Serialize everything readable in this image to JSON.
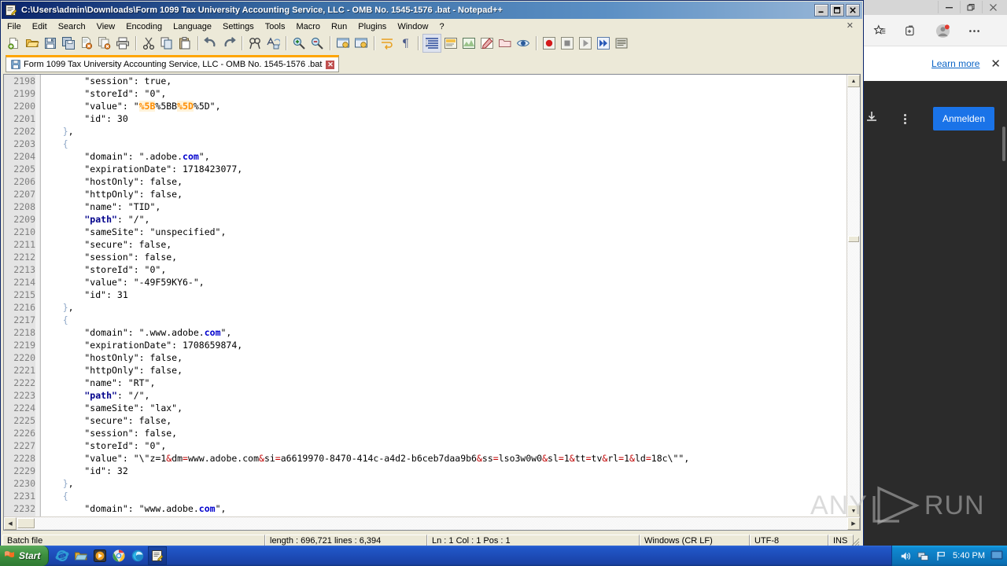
{
  "window": {
    "title": "C:\\Users\\admin\\Downloads\\Form 1099 Tax University Accounting Service, LLC - OMB No. 1545-1576 .bat - Notepad++",
    "icon": "notepad-plus-plus-icon",
    "minimize_label": "_",
    "maximize_label": "❐",
    "close_label": "✕"
  },
  "menu": {
    "items": [
      "File",
      "Edit",
      "Search",
      "View",
      "Encoding",
      "Language",
      "Settings",
      "Tools",
      "Macro",
      "Run",
      "Plugins",
      "Window",
      "?"
    ],
    "close_doc_label": "✕"
  },
  "toolbar": {
    "buttons": [
      {
        "name": "new-file-icon",
        "glyph": "new"
      },
      {
        "name": "open-file-icon",
        "glyph": "open"
      },
      {
        "name": "save-icon",
        "glyph": "save"
      },
      {
        "name": "save-all-icon",
        "glyph": "saveall"
      },
      {
        "name": "close-file-icon",
        "glyph": "close"
      },
      {
        "name": "close-all-files-icon",
        "glyph": "closeall"
      },
      {
        "name": "print-icon",
        "glyph": "print"
      },
      {
        "name": "cut-icon",
        "glyph": "cut"
      },
      {
        "name": "copy-icon",
        "glyph": "copy"
      },
      {
        "name": "paste-icon",
        "glyph": "paste"
      },
      {
        "name": "undo-icon",
        "glyph": "undo"
      },
      {
        "name": "redo-icon",
        "glyph": "redo"
      },
      {
        "name": "find-icon",
        "glyph": "find"
      },
      {
        "name": "replace-icon",
        "glyph": "replace"
      },
      {
        "name": "zoom-in-icon",
        "glyph": "zoomin"
      },
      {
        "name": "zoom-out-icon",
        "glyph": "zoomout"
      },
      {
        "name": "sync-vertical-scroll-icon",
        "glyph": "syncv"
      },
      {
        "name": "sync-horizontal-scroll-icon",
        "glyph": "synch"
      },
      {
        "name": "word-wrap-icon",
        "glyph": "wrap"
      },
      {
        "name": "show-all-characters-icon",
        "glyph": "pilcrow"
      },
      {
        "name": "indent-guide-icon",
        "glyph": "indent"
      },
      {
        "name": "user-defined-language-icon",
        "glyph": "udl"
      },
      {
        "name": "document-map-icon",
        "glyph": "map"
      },
      {
        "name": "function-list-icon",
        "glyph": "funclist"
      },
      {
        "name": "folder-as-workspace-icon",
        "glyph": "folderws"
      },
      {
        "name": "monitoring-icon",
        "glyph": "eye"
      },
      {
        "name": "record-macro-icon",
        "glyph": "record"
      },
      {
        "name": "stop-macro-icon",
        "glyph": "stop"
      },
      {
        "name": "play-macro-icon",
        "glyph": "play"
      },
      {
        "name": "run-macro-multiple-icon",
        "glyph": "playmulti"
      },
      {
        "name": "run-icon",
        "glyph": "run"
      }
    ]
  },
  "document_tab": {
    "label": "Form 1099 Tax University Accounting Service, LLC - OMB No. 1545-1576 .bat",
    "icon": "save-blue-icon",
    "close_label": "✕"
  },
  "editor": {
    "first_line_number": 2198,
    "lines": [
      {
        "n": 2198,
        "tokens": [
          {
            "t": "        \"session\": true,",
            "c": "k-key"
          }
        ]
      },
      {
        "n": 2199,
        "tokens": [
          {
            "t": "        \"storeId\": \"0\",",
            "c": "k-key"
          }
        ]
      },
      {
        "n": 2200,
        "tokens": [
          {
            "t": "        \"value\": \"",
            "c": "k-key"
          },
          {
            "t": "%5B",
            "c": "k-hl"
          },
          {
            "t": "%5BB",
            "c": "k-key"
          },
          {
            "t": "%5D",
            "c": "k-hl"
          },
          {
            "t": "%5D\",",
            "c": "k-key"
          }
        ]
      },
      {
        "n": 2201,
        "tokens": [
          {
            "t": "        \"id\": 30",
            "c": "k-key"
          }
        ]
      },
      {
        "n": 2202,
        "tokens": [
          {
            "t": "    }",
            "c": "k-brace"
          },
          {
            "t": ",",
            "c": "k-key"
          }
        ]
      },
      {
        "n": 2203,
        "tokens": [
          {
            "t": "    {",
            "c": "k-brace"
          }
        ]
      },
      {
        "n": 2204,
        "tokens": [
          {
            "t": "        \"domain\": \".adobe.",
            "c": "k-key"
          },
          {
            "t": "com",
            "c": "k-com"
          },
          {
            "t": "\",",
            "c": "k-key"
          }
        ]
      },
      {
        "n": 2205,
        "tokens": [
          {
            "t": "        \"expirationDate\": 1718423077,",
            "c": "k-key"
          }
        ]
      },
      {
        "n": 2206,
        "tokens": [
          {
            "t": "        \"hostOnly\": false,",
            "c": "k-key"
          }
        ]
      },
      {
        "n": 2207,
        "tokens": [
          {
            "t": "        \"httpOnly\": false,",
            "c": "k-key"
          }
        ]
      },
      {
        "n": 2208,
        "tokens": [
          {
            "t": "        \"name\": \"TID\",",
            "c": "k-key"
          }
        ]
      },
      {
        "n": 2209,
        "tokens": [
          {
            "t": "        \"path\"",
            "c": "k-path"
          },
          {
            "t": ": \"/\",",
            "c": "k-key"
          }
        ]
      },
      {
        "n": 2210,
        "tokens": [
          {
            "t": "        \"sameSite\": \"unspecified\",",
            "c": "k-key"
          }
        ]
      },
      {
        "n": 2211,
        "tokens": [
          {
            "t": "        \"secure\": false,",
            "c": "k-key"
          }
        ]
      },
      {
        "n": 2212,
        "tokens": [
          {
            "t": "        \"session\": false,",
            "c": "k-key"
          }
        ]
      },
      {
        "n": 2213,
        "tokens": [
          {
            "t": "        \"storeId\": \"0\",",
            "c": "k-key"
          }
        ]
      },
      {
        "n": 2214,
        "tokens": [
          {
            "t": "        \"value\": \"-49F59KY6-\",",
            "c": "k-key"
          }
        ]
      },
      {
        "n": 2215,
        "tokens": [
          {
            "t": "        \"id\": 31",
            "c": "k-key"
          }
        ]
      },
      {
        "n": 2216,
        "tokens": [
          {
            "t": "    }",
            "c": "k-brace"
          },
          {
            "t": ",",
            "c": "k-key"
          }
        ]
      },
      {
        "n": 2217,
        "tokens": [
          {
            "t": "    {",
            "c": "k-brace"
          }
        ]
      },
      {
        "n": 2218,
        "tokens": [
          {
            "t": "        \"domain\": \".www.adobe.",
            "c": "k-key"
          },
          {
            "t": "com",
            "c": "k-com"
          },
          {
            "t": "\",",
            "c": "k-key"
          }
        ]
      },
      {
        "n": 2219,
        "tokens": [
          {
            "t": "        \"expirationDate\": 1708659874,",
            "c": "k-key"
          }
        ]
      },
      {
        "n": 2220,
        "tokens": [
          {
            "t": "        \"hostOnly\": false,",
            "c": "k-key"
          }
        ]
      },
      {
        "n": 2221,
        "tokens": [
          {
            "t": "        \"httpOnly\": false,",
            "c": "k-key"
          }
        ]
      },
      {
        "n": 2222,
        "tokens": [
          {
            "t": "        \"name\": \"RT\",",
            "c": "k-key"
          }
        ]
      },
      {
        "n": 2223,
        "tokens": [
          {
            "t": "        \"path\"",
            "c": "k-path"
          },
          {
            "t": ": \"/\",",
            "c": "k-key"
          }
        ]
      },
      {
        "n": 2224,
        "tokens": [
          {
            "t": "        \"sameSite\": \"lax\",",
            "c": "k-key"
          }
        ]
      },
      {
        "n": 2225,
        "tokens": [
          {
            "t": "        \"secure\": false,",
            "c": "k-key"
          }
        ]
      },
      {
        "n": 2226,
        "tokens": [
          {
            "t": "        \"session\": false,",
            "c": "k-key"
          }
        ]
      },
      {
        "n": 2227,
        "tokens": [
          {
            "t": "        \"storeId\": \"0\",",
            "c": "k-key"
          }
        ]
      },
      {
        "n": 2228,
        "tokens": [
          {
            "t": "        \"value\": \"\\\"z=1",
            "c": "k-key"
          },
          {
            "t": "&",
            "c": "k-amp"
          },
          {
            "t": "dm",
            "c": "k-key"
          },
          {
            "t": "=",
            "c": "k-amp"
          },
          {
            "t": "www.adobe.com",
            "c": "k-key"
          },
          {
            "t": "&",
            "c": "k-amp"
          },
          {
            "t": "si",
            "c": "k-key"
          },
          {
            "t": "=",
            "c": "k-amp"
          },
          {
            "t": "a6619970-8470-414c-a4d2-b6ceb7daa9b6",
            "c": "k-key"
          },
          {
            "t": "&",
            "c": "k-amp"
          },
          {
            "t": "ss",
            "c": "k-key"
          },
          {
            "t": "=",
            "c": "k-amp"
          },
          {
            "t": "lso3w0w0",
            "c": "k-key"
          },
          {
            "t": "&",
            "c": "k-amp"
          },
          {
            "t": "sl",
            "c": "k-key"
          },
          {
            "t": "=",
            "c": "k-amp"
          },
          {
            "t": "1",
            "c": "k-key"
          },
          {
            "t": "&",
            "c": "k-amp"
          },
          {
            "t": "tt",
            "c": "k-key"
          },
          {
            "t": "=",
            "c": "k-amp"
          },
          {
            "t": "tv",
            "c": "k-key"
          },
          {
            "t": "&",
            "c": "k-amp"
          },
          {
            "t": "rl",
            "c": "k-key"
          },
          {
            "t": "=",
            "c": "k-amp"
          },
          {
            "t": "1",
            "c": "k-key"
          },
          {
            "t": "&",
            "c": "k-amp"
          },
          {
            "t": "ld",
            "c": "k-key"
          },
          {
            "t": "=",
            "c": "k-amp"
          },
          {
            "t": "18c\\\"\",",
            "c": "k-key"
          }
        ]
      },
      {
        "n": 2229,
        "tokens": [
          {
            "t": "        \"id\": 32",
            "c": "k-key"
          }
        ]
      },
      {
        "n": 2230,
        "tokens": [
          {
            "t": "    }",
            "c": "k-brace"
          },
          {
            "t": ",",
            "c": "k-key"
          }
        ]
      },
      {
        "n": 2231,
        "tokens": [
          {
            "t": "    {",
            "c": "k-brace"
          }
        ]
      },
      {
        "n": 2232,
        "tokens": [
          {
            "t": "        \"domain\": \"www.adobe.",
            "c": "k-key"
          },
          {
            "t": "com",
            "c": "k-com"
          },
          {
            "t": "\",",
            "c": "k-key"
          }
        ]
      }
    ]
  },
  "statusbar": {
    "language": "Batch file",
    "length_lines": "length : 696,721   lines : 6,394",
    "caret": "Ln : 1    Col : 1    Pos : 1",
    "eol": "Windows (CR LF)",
    "encoding": "UTF-8",
    "insert_mode": "INS"
  },
  "edge": {
    "window_buttons": [
      "minimize-icon",
      "restore-icon",
      "close-icon"
    ],
    "toolbar_icons": [
      "favorites-icon",
      "collections-icon",
      "profile-icon",
      "settings-more-icon"
    ],
    "notice": {
      "link": "Learn more",
      "close": "✕"
    },
    "download_icon": "download-icon",
    "more_icon": "more-vertical-icon",
    "signin_label": "Anmelden"
  },
  "taskbar": {
    "start_label": "Start",
    "quick_launch": [
      {
        "name": "internet-explorer-icon"
      },
      {
        "name": "file-explorer-icon"
      },
      {
        "name": "media-player-icon"
      },
      {
        "name": "google-chrome-icon"
      },
      {
        "name": "microsoft-edge-icon"
      },
      {
        "name": "notepad-plus-plus-taskbar-icon"
      }
    ],
    "tray": {
      "volume_icon": "volume-icon",
      "network_icon": "network-icon",
      "flag_icon": "flag-icon",
      "time": "5:40 PM",
      "show_desktop_icon": "show-desktop-icon"
    }
  },
  "watermark": {
    "text_left": "ANY",
    "text_right": "RUN"
  },
  "colors": {
    "title_bar_start": "#0a246a",
    "accent_tab": "#ffa500",
    "signin_blue": "#1a73e8",
    "link_blue": "#0b64c6",
    "code_keyword": "#00008b",
    "code_highlight": "#ff8c00",
    "code_amp": "#c00000"
  }
}
